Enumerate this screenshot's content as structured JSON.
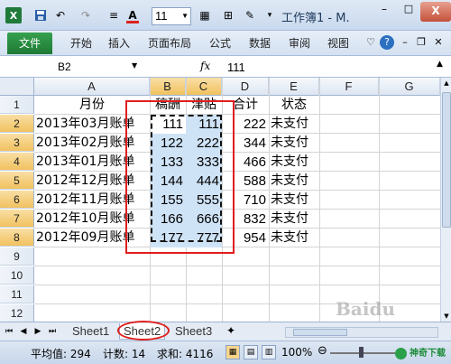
{
  "titlebar": {
    "app_logo": "X",
    "title": "工作簿1 - M.",
    "font_size": "11",
    "minimize": "–",
    "maximize": "□",
    "close": "X"
  },
  "ribbon": {
    "file": "文件",
    "tabs": [
      "开始",
      "插入",
      "页面布局",
      "公式",
      "数据",
      "审阅",
      "视图"
    ]
  },
  "formula_bar": {
    "name_box": "B2",
    "fx": "fx",
    "value": "111"
  },
  "columns": [
    "A",
    "B",
    "C",
    "D",
    "E",
    "F",
    "G"
  ],
  "rows": [
    "1",
    "2",
    "3",
    "4",
    "5",
    "6",
    "7",
    "8",
    "9",
    "10",
    "11",
    "12"
  ],
  "sheet": {
    "headers": {
      "a": "月份",
      "b": "稿酬",
      "c": "津贴",
      "d": "合计",
      "e": "状态"
    },
    "data": [
      {
        "a": "2013年03月账单",
        "b": "111",
        "c": "111",
        "d": "222",
        "e": "未支付"
      },
      {
        "a": "2013年02月账单",
        "b": "122",
        "c": "222",
        "d": "344",
        "e": "未支付"
      },
      {
        "a": "2013年01月账单",
        "b": "133",
        "c": "333",
        "d": "466",
        "e": "未支付"
      },
      {
        "a": "2012年12月账单",
        "b": "144",
        "c": "444",
        "d": "588",
        "e": "未支付"
      },
      {
        "a": "2012年11月账单",
        "b": "155",
        "c": "555",
        "d": "710",
        "e": "未支付"
      },
      {
        "a": "2012年10月账单",
        "b": "166",
        "c": "666",
        "d": "832",
        "e": "未支付"
      },
      {
        "a": "2012年09月账单",
        "b": "177",
        "c": "777",
        "d": "954",
        "e": "未支付"
      }
    ]
  },
  "sheet_tabs": [
    "Sheet1",
    "Sheet2",
    "Sheet3"
  ],
  "status": {
    "average": "平均值: 294",
    "count": "计数: 14",
    "sum": "求和: 4116",
    "zoom": "100%"
  },
  "watermark": "Baidu",
  "brand": "神奇下载"
}
